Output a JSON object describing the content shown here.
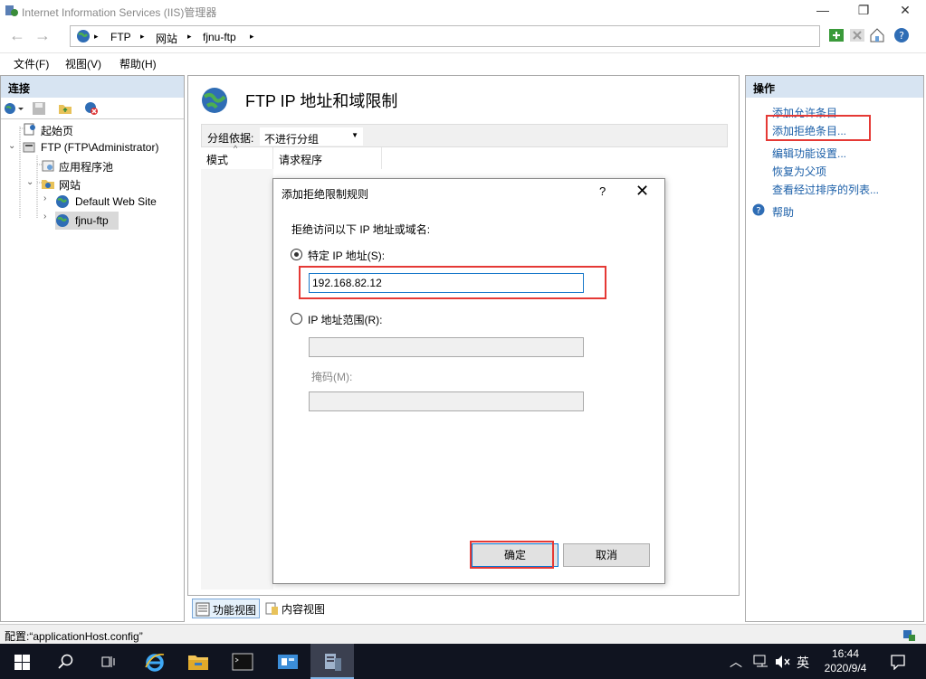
{
  "window": {
    "title": "Internet Information Services (IIS)管理器",
    "minimize": "—",
    "maximize": "❐",
    "close": "✕"
  },
  "address": {
    "back": "←",
    "forward": "→",
    "crumbs": [
      "FTP",
      "网站",
      "fjnu-ftp"
    ],
    "sep": "▸"
  },
  "menu": [
    "文件(F)",
    "视图(V)",
    "帮助(H)"
  ],
  "left": {
    "header": "连接",
    "tree": [
      {
        "label": "起始页"
      },
      {
        "label": "FTP (FTP\\Administrator)"
      },
      {
        "label": "应用程序池"
      },
      {
        "label": "网站"
      },
      {
        "label": "Default Web Site"
      },
      {
        "label": "fjnu-ftp"
      }
    ]
  },
  "center": {
    "title": "FTP IP 地址和域限制",
    "group_label": "分组依据:",
    "group_value": "不进行分组",
    "columns": [
      "模式",
      "请求程序"
    ],
    "tabs": [
      "功能视图",
      "内容视图"
    ]
  },
  "right": {
    "header": "操作",
    "actions": [
      "添加允许条目...",
      "添加拒绝条目...",
      "编辑功能设置...",
      "恢复为父项",
      "查看经过排序的列表...",
      "帮助"
    ]
  },
  "dialog": {
    "title": "添加拒绝限制规则",
    "help": "?",
    "close": "✕",
    "prompt": "拒绝访问以下 IP 地址或域名:",
    "specific_ip_label": "特定 IP 地址(S):",
    "specific_ip_value": "192.168.82.12",
    "range_label": "IP 地址范围(R):",
    "range_value": "",
    "mask_label": "掩码(M):",
    "mask_value": "",
    "ok": "确定",
    "cancel": "取消"
  },
  "status": {
    "text": "配置:“applicationHost.config”"
  },
  "taskbar": {
    "time": "16:44",
    "date": "2020/9/4",
    "ime": "英"
  },
  "colors": {
    "link": "#1b5fa8",
    "panel_header": "#d7e4f2",
    "highlight": "#e53935",
    "taskbar": "#101420"
  }
}
